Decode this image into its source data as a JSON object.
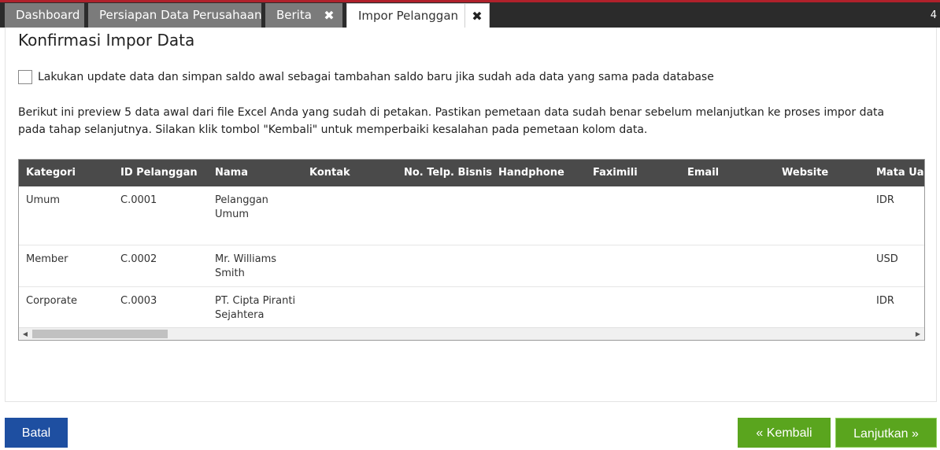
{
  "tabs": [
    {
      "label": "Dashboard",
      "closable": false,
      "active": false
    },
    {
      "label": "Persiapan Data Perusahaan",
      "closable": false,
      "active": false
    },
    {
      "label": "Berita",
      "closable": true,
      "active": false
    },
    {
      "label": "Impor Pelanggan",
      "closable": true,
      "active": true
    }
  ],
  "tab_close_glyph": "✖",
  "tab_counter": "4",
  "colors": {
    "tab_bar": "#2b2b2b",
    "tab_inactive": "#7b7b7b",
    "accent_red": "#b0212b",
    "table_header": "#4a4a4a",
    "button_blue": "#1e4fa1",
    "button_green": "#5aa51e"
  },
  "page": {
    "title": "Konfirmasi Impor Data",
    "checkbox_label": "Lakukan update data dan simpan saldo awal sebagai tambahan saldo baru jika sudah ada data yang sama pada database",
    "checkbox_checked": false,
    "info_line_1": "Berikut ini preview 5 data awal dari file Excel Anda yang sudah di petakan. Pastikan pemetaan data sudah benar sebelum melanjutkan ke proses impor data",
    "info_line_2": "pada tahap selanjutnya. Silakan klik tombol \"Kembali\" untuk memperbaiki kesalahan pada pemetaan kolom data."
  },
  "table": {
    "columns": [
      "Kategori",
      "ID Pelanggan",
      "Nama",
      "Kontak",
      "No. Telp. Bisnis",
      "Handphone",
      "Faximili",
      "Email",
      "Website",
      "Mata Uang"
    ],
    "rows": [
      [
        "Umum",
        "C.0001",
        "Pelanggan Umum",
        "",
        "",
        "",
        "",
        "",
        "",
        "IDR"
      ],
      [
        "Member",
        "C.0002",
        "Mr. Williams Smith",
        "",
        "",
        "",
        "",
        "",
        "",
        "USD"
      ],
      [
        "Corporate",
        "C.0003",
        "PT. Cipta Piranti Sejahtera",
        "",
        "",
        "",
        "",
        "",
        "",
        "IDR"
      ]
    ]
  },
  "scrollbar": {
    "left_arrow": "◀",
    "right_arrow": "▶"
  },
  "buttons": {
    "cancel": "Batal",
    "back": "« Kembali",
    "next": "Lanjutkan »"
  }
}
